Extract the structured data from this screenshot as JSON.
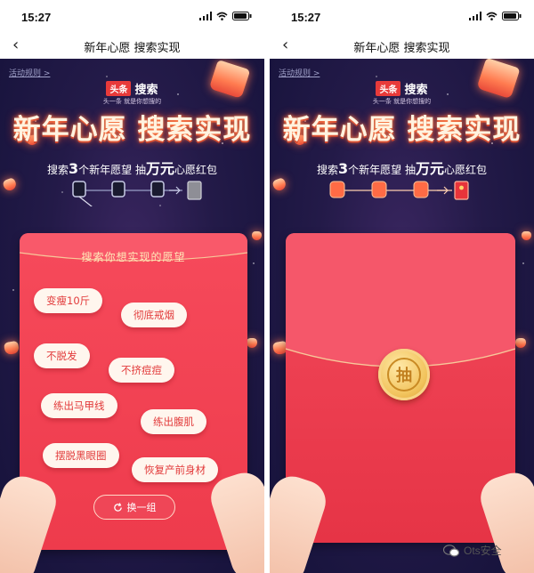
{
  "status": {
    "time": "15:27"
  },
  "nav": {
    "back_glyph": "‹",
    "title": "新年心愿 搜索实现"
  },
  "page": {
    "rules_link": "活动规则 >",
    "logo_badge": "头条",
    "logo_text": "搜索",
    "slogan": "头一条  就是你想搜的",
    "main_title": "新年心愿 搜索实现",
    "subtitle": {
      "prefix": "搜索",
      "count": "3",
      "middle": "个新年愿望  抽",
      "amount": "万元",
      "suffix": "心愿红包"
    }
  },
  "card": {
    "title": "搜索你想实现的愿望",
    "wishes": [
      "变瘦10斤",
      "彻底戒烟",
      "不脱发",
      "不挤痘痘",
      "练出马甲线",
      "练出腹肌",
      "摆脱黑眼圈",
      "恢复产前身材"
    ],
    "swap_label": "换一组",
    "swap_icon": "refresh-icon"
  },
  "envelope": {
    "coin_char": "抽"
  },
  "watermark": {
    "text": "Ots安全",
    "icon": "wechat-icon"
  },
  "colors": {
    "accent_red": "#ee3b4c",
    "night_bg": "#231a48",
    "cream": "#fff6ee",
    "gold": "#f2c45e"
  }
}
